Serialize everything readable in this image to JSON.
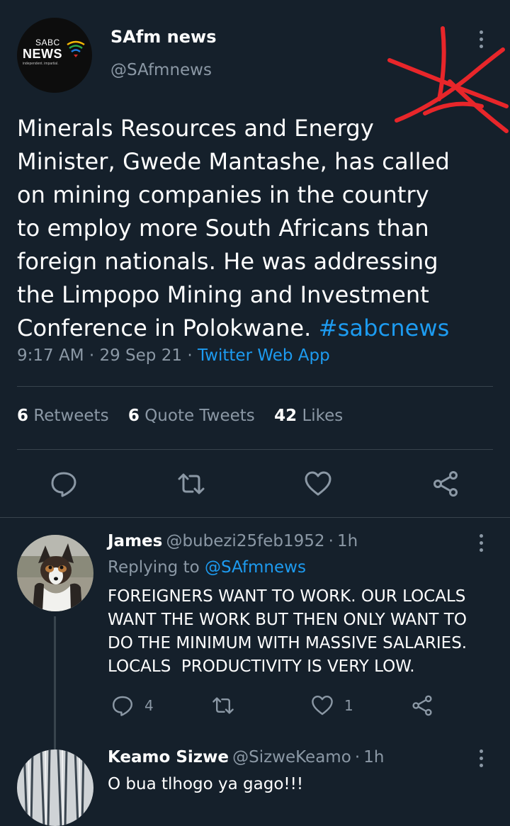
{
  "main_tweet": {
    "avatar_logo": {
      "line1": "SABC",
      "line2": "NEWS",
      "tagline": "independent. impartial."
    },
    "display_name": "SAfm news",
    "handle": "@SAfmnews",
    "text_lines": [
      "Minerals Resources and Energy",
      "Minister, Gwede Mantashe, has called",
      "on mining companies in the country",
      "to employ more South Africans than",
      "foreign nationals. He was addressing",
      "the Limpopo Mining and Investment",
      "Conference in Polokwane."
    ],
    "hashtag": "#sabcnews",
    "time": "9:17 AM",
    "date": "29 Sep 21",
    "source": "Twitter Web App",
    "retweets_count": "6",
    "retweets_label": "Retweets",
    "quotes_count": "6",
    "quotes_label": "Quote Tweets",
    "likes_count": "42",
    "likes_label": "Likes"
  },
  "replies": [
    {
      "display_name": "James",
      "handle": "@bubezi25feb1952",
      "age": "1h",
      "replying_to_label": "Replying to",
      "replying_to_handle": "@SAfmnews",
      "text_lines": [
        "FOREIGNERS WANT TO WORK. OUR LOCALS",
        "WANT THE WORK BUT THEN ONLY WANT TO",
        "DO THE MINIMUM WITH MASSIVE SALARIES.",
        "LOCALS  PRODUCTIVITY IS VERY LOW."
      ],
      "reply_count": "4",
      "like_count": "1"
    },
    {
      "display_name": "Keamo Sizwe",
      "handle": "@SizweKeamo",
      "age": "1h",
      "text": "O bua tlhogo ya gago!!!"
    }
  ],
  "colors": {
    "background": "#15202b",
    "accent": "#1d9bf0",
    "muted": "#8b98a5",
    "divider": "#38444d",
    "scribble": "#e8262a"
  },
  "icons": [
    "reply-icon",
    "retweet-icon",
    "like-icon",
    "share-icon",
    "more-icon"
  ]
}
